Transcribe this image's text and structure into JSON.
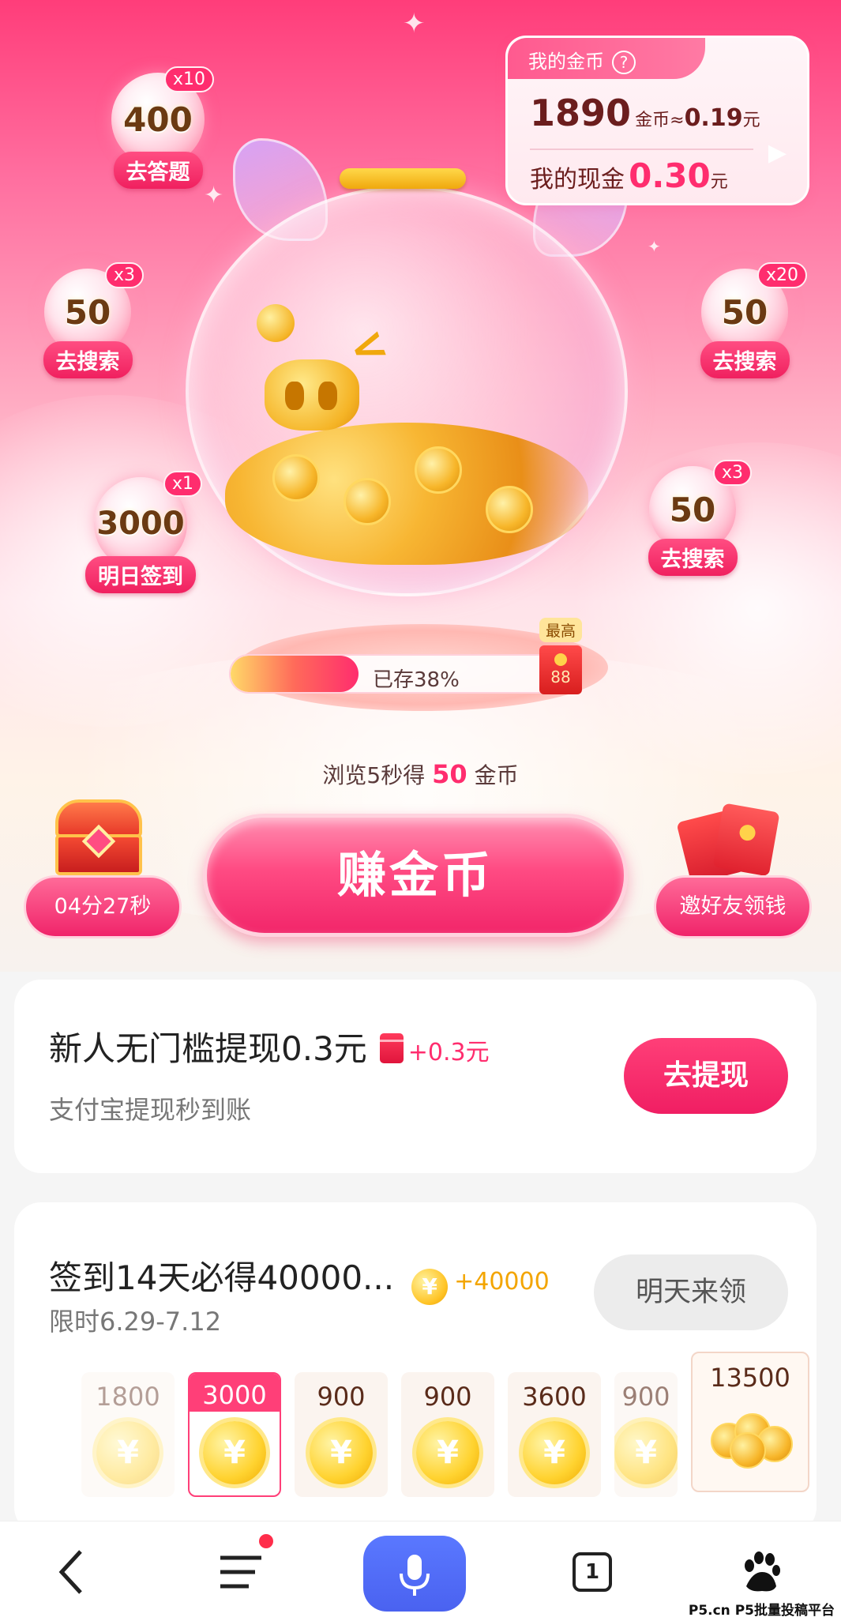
{
  "wallet": {
    "title": "我的金币",
    "help_icon": "?",
    "coins": "1890",
    "coins_unit": "金币≈",
    "coins_cash": "0.19",
    "yuan": "元",
    "cash_label": "我的现金",
    "cash": "0.30",
    "cash_unit": "元"
  },
  "bubbles": [
    {
      "value": "400",
      "mult": "x10",
      "label": "去答题"
    },
    {
      "value": "50",
      "mult": "x3",
      "label": "去搜索"
    },
    {
      "value": "3000",
      "mult": "x1",
      "label": "明日签到"
    },
    {
      "value": "50",
      "mult": "x20",
      "label": "去搜索"
    },
    {
      "value": "50",
      "mult": "x3",
      "label": "去搜索"
    }
  ],
  "progress": {
    "text": "已存38%",
    "percent": 38,
    "max_label": "最高",
    "max_value": "88"
  },
  "earn": {
    "browse_prefix": "浏览5秒得",
    "browse_value": "50",
    "browse_suffix": "金币",
    "button": "赚金币",
    "timer": "04分27秒",
    "invite": "邀好友领钱"
  },
  "withdraw_card": {
    "title": "新人无门槛提现0.3元",
    "reward": "+0.3元",
    "subtitle": "支付宝提现秒到账",
    "button": "去提现"
  },
  "signin_card": {
    "title": "签到14天必得40000...",
    "coin_symbol": "¥",
    "reward": "+40000",
    "subtitle": "限时6.29-7.12",
    "button": "明天来领",
    "days": [
      "1800",
      "3000",
      "900",
      "900",
      "3600",
      "900"
    ],
    "final": "13500"
  },
  "nav": {
    "tab_count": "1",
    "watermark": "P5.cn P5批量投稿平台"
  },
  "colors": {
    "accent": "#ff2d6e",
    "gold": "#f3a500",
    "mic": "#4a62f0"
  }
}
